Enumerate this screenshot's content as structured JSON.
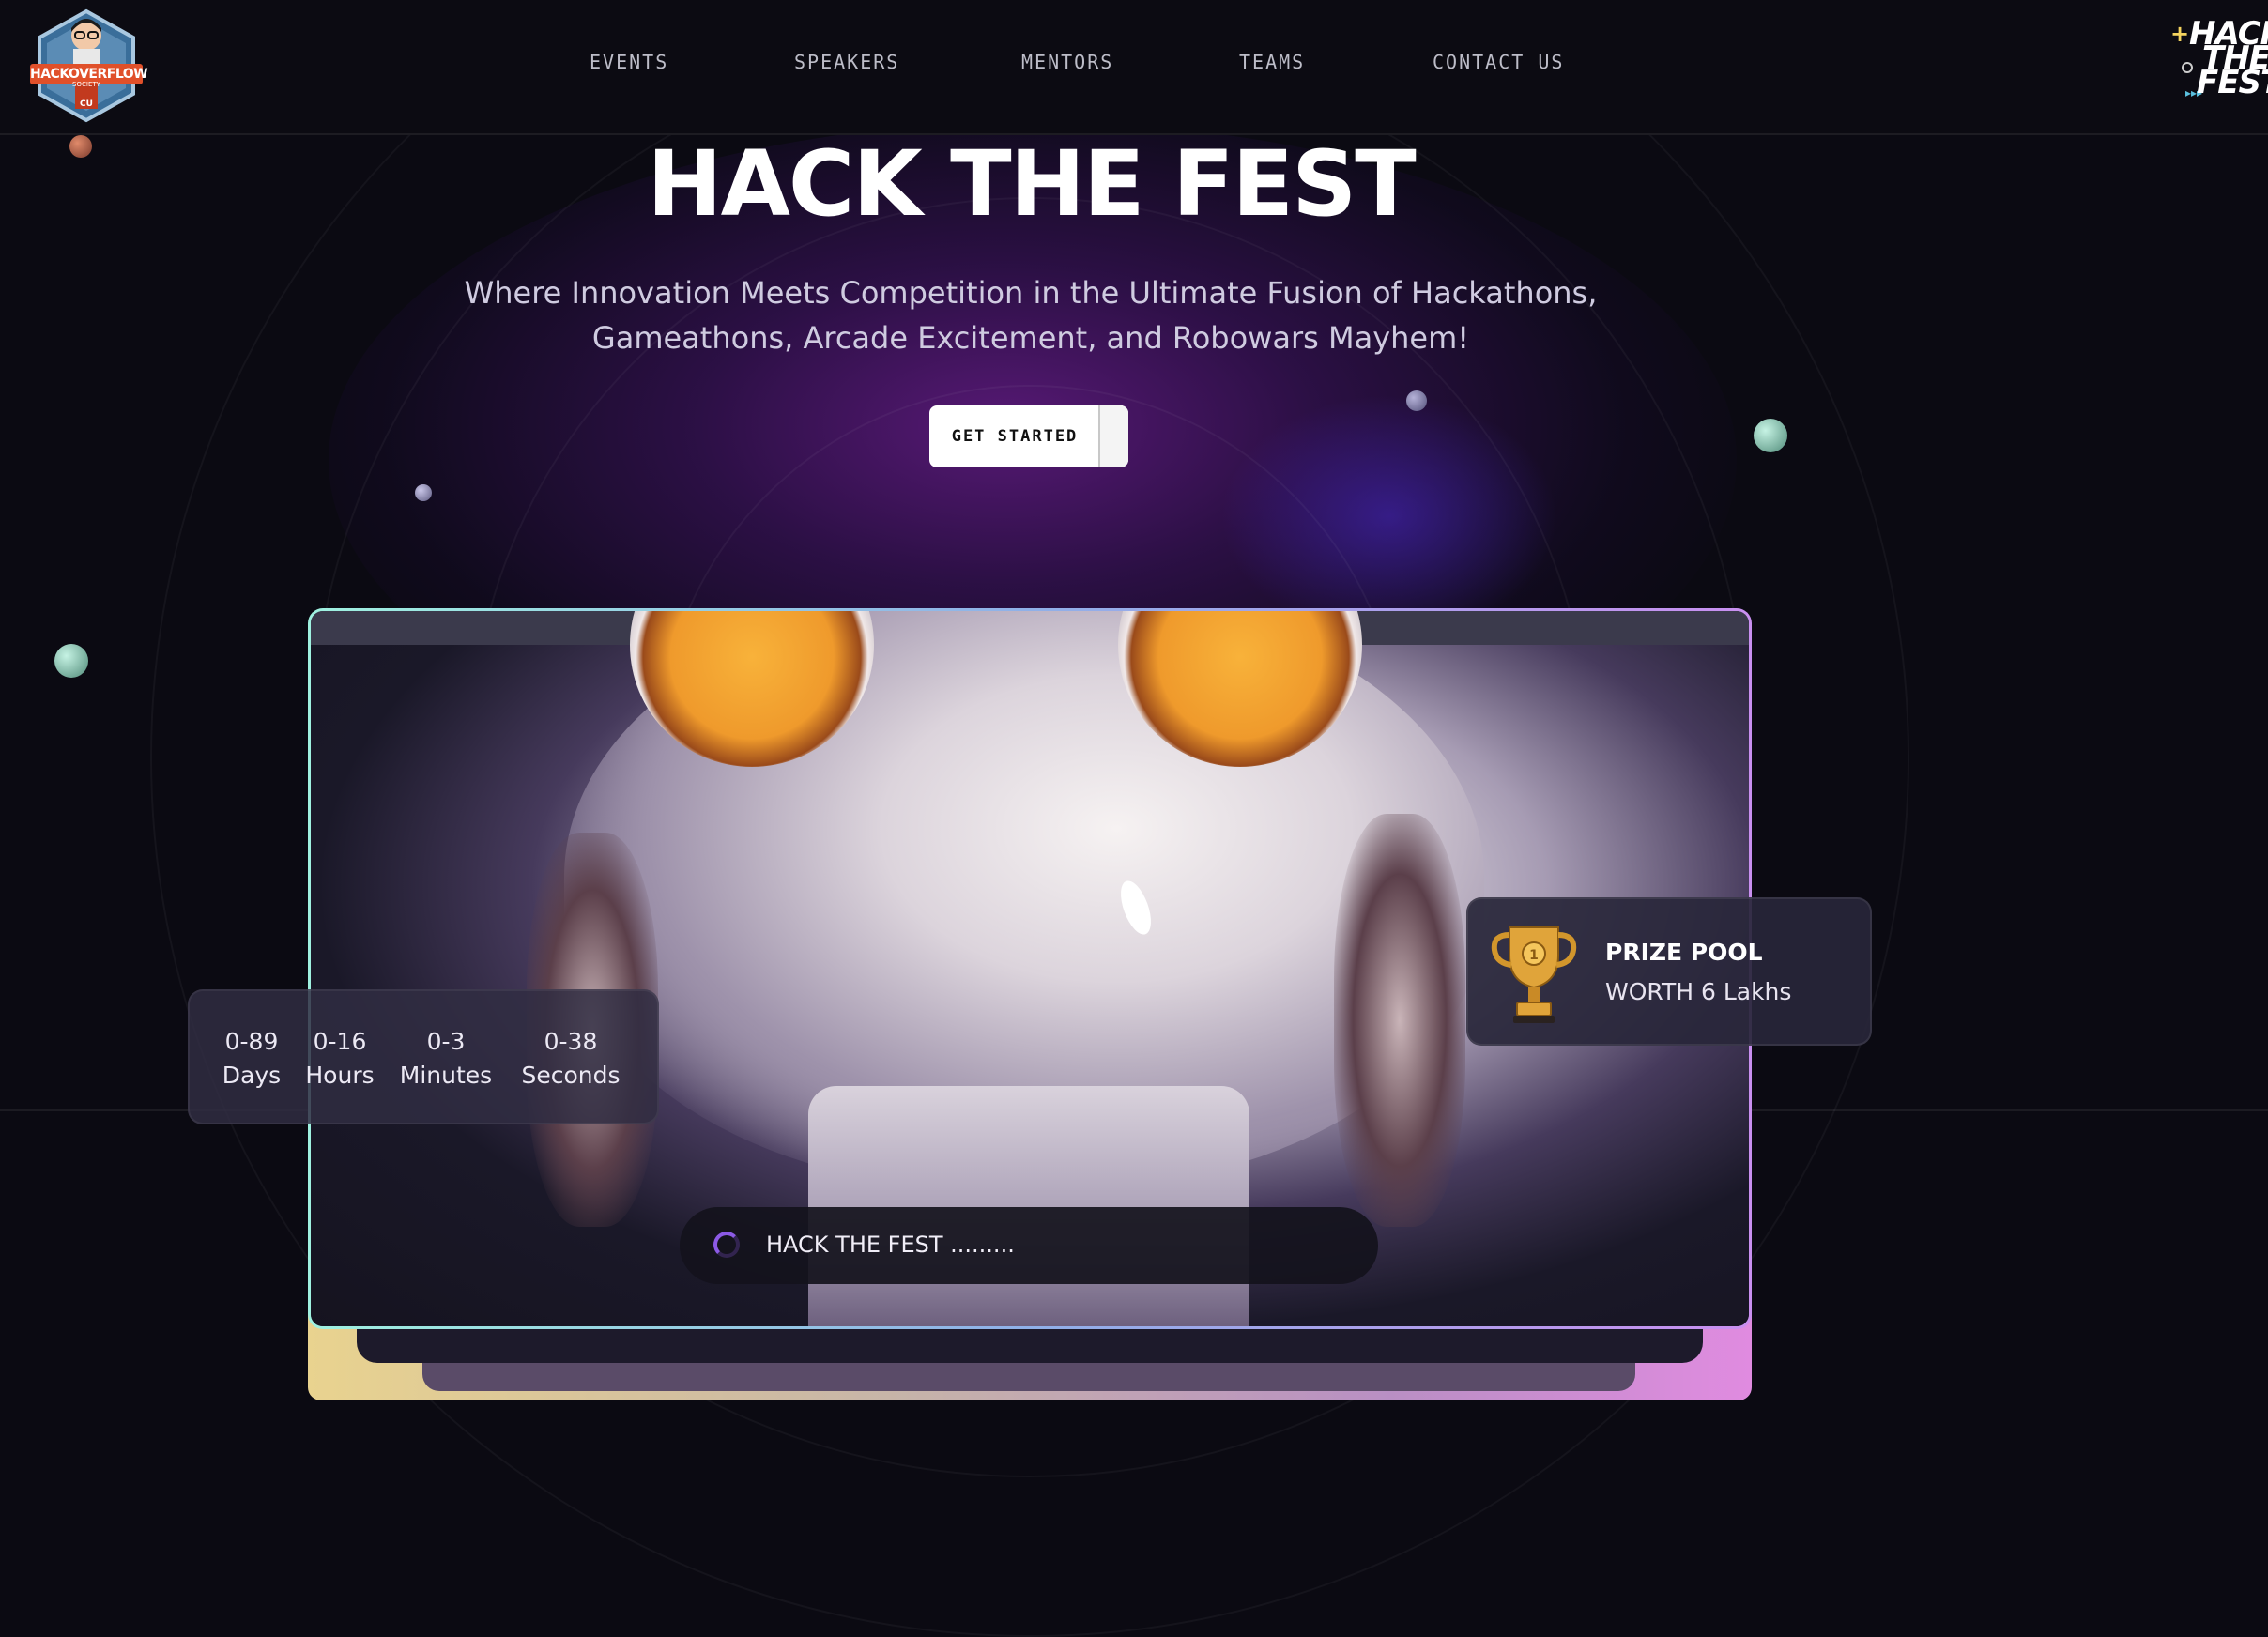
{
  "header": {
    "logo": {
      "text": "HACKOVERFLOW",
      "sub": "SOCIETY",
      "badge": "CU"
    },
    "nav": [
      {
        "label": "EVENTS"
      },
      {
        "label": "SPEAKERS"
      },
      {
        "label": "MENTORS"
      },
      {
        "label": "TEAMS"
      },
      {
        "label": "CONTACT US"
      }
    ],
    "brand": {
      "line1": "HACK",
      "line2": "THE",
      "line3": "FEST"
    }
  },
  "hero": {
    "title": "HACK THE FEST",
    "subtitle_line1": "Where Innovation Meets Competition in the Ultimate Fusion of Hackathons,",
    "subtitle_line2": "Gameathons, Arcade Excitement, and Robowars Mayhem!",
    "cta_label": "GET STARTED"
  },
  "countdown": [
    {
      "value": "0-89",
      "unit": "Days"
    },
    {
      "value": "0-16",
      "unit": "Hours"
    },
    {
      "value": "0-3",
      "unit": "Minutes"
    },
    {
      "value": "0-38",
      "unit": "Seconds"
    }
  ],
  "prize": {
    "title": "PRIZE POOL",
    "subtitle": "WORTH 6 Lakhs",
    "icon": "trophy-icon"
  },
  "status": {
    "text": "HACK THE FEST ........."
  },
  "colors": {
    "background": "#0b0a12",
    "glow": "#701e96",
    "cta_bg": "#ffffff",
    "frame_border_start": "#9ff1e0",
    "frame_border_end": "#c98ff0",
    "frame_bottom_start": "#e9d38f",
    "frame_bottom_end": "#e08be0",
    "eye": "#f3a43a",
    "trophy": "#e0a43a",
    "spinner": "#8c5ae6"
  }
}
